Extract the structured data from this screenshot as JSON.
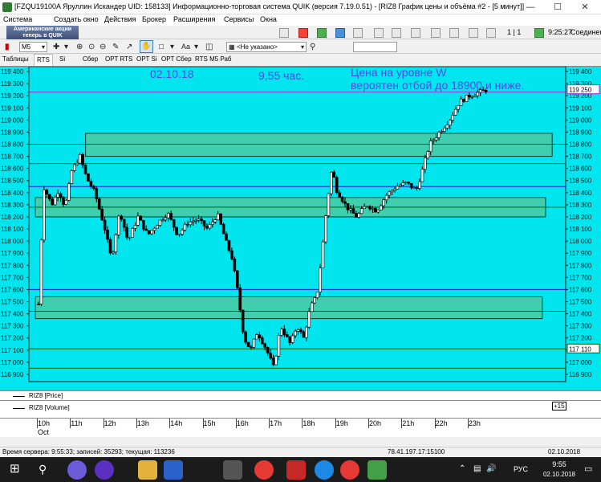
{
  "window": {
    "title": "[FZQU19100A Яруллин Искандер UID: 158133] Информационно-торговая система QUIK (версия 7.19.0.51) - [RIZ8 График цены и объёма #2 - [5 минут]]",
    "min_icon": "minimize-icon",
    "max_icon": "maximize-icon",
    "close_icon": "close-icon"
  },
  "menu": [
    "Система",
    "Создать окно",
    "Действия",
    "Брокер",
    "Расширения",
    "Сервисы",
    "Окна"
  ],
  "toolbar": {
    "banner_line1": "Американские акции",
    "banner_line2": "теперь в QUIK",
    "page": "1 | 1",
    "time": "9:25:27",
    "connection": "Соединен"
  },
  "chart_toolbar": {
    "interval": "M5",
    "account_placeholder": "<Не указано>"
  },
  "tabs": [
    "Таблицы",
    "RTS",
    "Si",
    "Сбер",
    "OPT RTS",
    "OPT Si",
    "OPT Сбер",
    "RTS M5 Раб"
  ],
  "active_tab": 1,
  "annotations": {
    "date": "02.10.18",
    "time": "9,55 час.",
    "line1": "Цена на уровне W",
    "line2": "вероятен отбой до 18900 и ниже."
  },
  "legend": {
    "price": "RIZ8 [Price]",
    "volume": "RIZ8 [Volume]"
  },
  "time_axis": {
    "hours": [
      "10h",
      "11h",
      "12h",
      "13h",
      "14h",
      "15h",
      "16h",
      "17h",
      "18h",
      "19h",
      "20h",
      "21h",
      "22h",
      "23h"
    ],
    "month": "Oct"
  },
  "status": {
    "text": "Время сервера: 9:55:33; записей: 35293; текущая: 113236",
    "server": "78.41.197.17:15100",
    "date": "02.10.2018"
  },
  "taskbar": {
    "lang": "РУС",
    "time": "9:55",
    "date": "02.10.2018"
  },
  "colors": {
    "chart_bg": "#00e5ee",
    "zone_fill": "#3fcfae",
    "hline_blue": "#2020d0",
    "hline_green": "#006400",
    "hline_purple": "#9b30d0",
    "annotation": "#4e4ee0"
  },
  "chart_data": {
    "type": "candlestick",
    "title": "",
    "ylim": [
      116850,
      119450
    ],
    "y_ticks": [
      116900,
      117000,
      117100,
      117200,
      117300,
      117400,
      117500,
      117600,
      117700,
      117800,
      117900,
      118000,
      118100,
      118200,
      118300,
      118400,
      118500,
      118600,
      118700,
      118800,
      118900,
      119000,
      119100,
      119200,
      119300,
      119400
    ],
    "current_price": 119250,
    "right_label_2": 117110,
    "horizontal_lines": [
      {
        "price": 119230,
        "color": "#9b30d0"
      },
      {
        "price": 118800,
        "color": "#006400"
      },
      {
        "price": 118640,
        "color": "#006400"
      },
      {
        "price": 118450,
        "color": "#2020d0"
      },
      {
        "price": 118280,
        "color": "#006400"
      },
      {
        "price": 117600,
        "color": "#2020d0"
      },
      {
        "price": 117420,
        "color": "#006400"
      },
      {
        "price": 117110,
        "color": "#006400"
      },
      {
        "price": 116950,
        "color": "#006400"
      }
    ],
    "zones": [
      {
        "hour_start": 11.42,
        "hour_end": 25.5,
        "price_top": 118890,
        "price_bottom": 118700
      },
      {
        "hour_start": 9.9,
        "hour_end": 25.3,
        "price_top": 118360,
        "price_bottom": 118200
      },
      {
        "hour_start": 9.9,
        "hour_end": 25.2,
        "price_top": 117540,
        "price_bottom": 117360
      }
    ],
    "hour_ticks": [
      10,
      11,
      12,
      13,
      14,
      15,
      16,
      17,
      18,
      19,
      20,
      21,
      22,
      23
    ],
    "path_points": [
      [
        10.0,
        117480
      ],
      [
        10.15,
        118450
      ],
      [
        10.4,
        118300
      ],
      [
        10.6,
        118420
      ],
      [
        10.8,
        118280
      ],
      [
        11.0,
        118580
      ],
      [
        11.25,
        118700
      ],
      [
        11.45,
        118520
      ],
      [
        11.7,
        118400
      ],
      [
        12.0,
        118100
      ],
      [
        12.2,
        117850
      ],
      [
        12.45,
        118250
      ],
      [
        12.7,
        118000
      ],
      [
        13.0,
        118200
      ],
      [
        13.3,
        118050
      ],
      [
        13.6,
        118150
      ],
      [
        13.9,
        118230
      ],
      [
        14.2,
        118050
      ],
      [
        14.5,
        118150
      ],
      [
        14.8,
        118180
      ],
      [
        15.1,
        118100
      ],
      [
        15.4,
        118220
      ],
      [
        15.65,
        118000
      ],
      [
        15.85,
        117850
      ],
      [
        16.0,
        117600
      ],
      [
        16.2,
        117200
      ],
      [
        16.4,
        117100
      ],
      [
        16.6,
        117250
      ],
      [
        16.85,
        117120
      ],
      [
        17.1,
        116950
      ],
      [
        17.3,
        117300
      ],
      [
        17.6,
        117150
      ],
      [
        17.8,
        117300
      ],
      [
        18.0,
        117200
      ],
      [
        18.2,
        117450
      ],
      [
        18.4,
        117550
      ],
      [
        18.55,
        117900
      ],
      [
        18.7,
        118300
      ],
      [
        18.85,
        118600
      ],
      [
        19.0,
        118420
      ],
      [
        19.3,
        118280
      ],
      [
        19.6,
        118200
      ],
      [
        19.9,
        118300
      ],
      [
        20.2,
        118250
      ],
      [
        20.5,
        118380
      ],
      [
        20.8,
        118450
      ],
      [
        21.1,
        118480
      ],
      [
        21.4,
        118420
      ],
      [
        21.6,
        118600
      ],
      [
        21.8,
        118800
      ],
      [
        22.1,
        118900
      ],
      [
        22.4,
        119000
      ],
      [
        22.7,
        119150
      ],
      [
        23.0,
        119200
      ],
      [
        23.3,
        119230
      ],
      [
        23.55,
        119250
      ]
    ]
  }
}
